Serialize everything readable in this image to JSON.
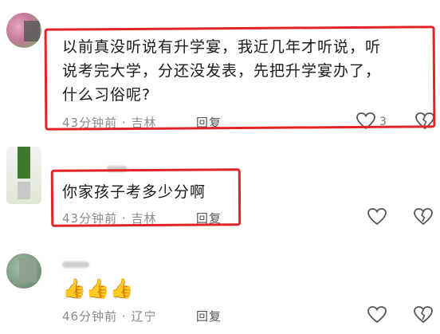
{
  "comments": [
    {
      "text_lines": [
        "以前真没听说有升学宴，我近几年才听说，听",
        "说考完大学，分还没发表，先把升学宴办了，",
        "什么习俗呢?"
      ],
      "time": "43分钟前",
      "location": "吉林",
      "reply_label": "回复",
      "like_count": "3",
      "avatar_icon": "avatar-icon",
      "like_icon": "heart-outline-icon",
      "dislike_icon": "broken-heart-icon"
    },
    {
      "text_lines": [
        "你家孩子考多少分啊"
      ],
      "time": "43分钟前",
      "location": "吉林",
      "reply_label": "回复",
      "like_count": "",
      "avatar_icon": "avatar-icon",
      "like_icon": "heart-outline-icon",
      "dislike_icon": "broken-heart-icon"
    },
    {
      "text_lines": [
        "👍👍👍"
      ],
      "time": "46分钟前",
      "location": "辽宁",
      "reply_label": "回复",
      "like_count": "",
      "avatar_icon": "avatar-icon",
      "like_icon": "heart-outline-icon",
      "dislike_icon": "broken-heart-icon"
    }
  ],
  "separator": "·",
  "highlight_color": "#e0242a"
}
